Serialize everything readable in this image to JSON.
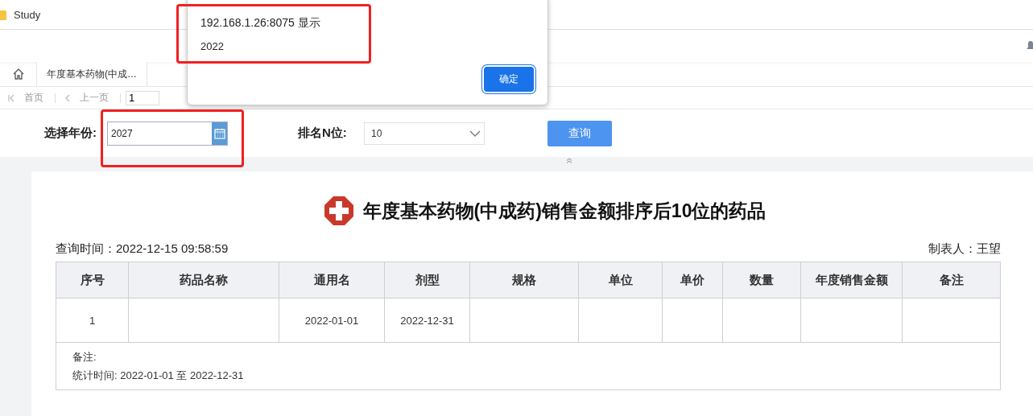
{
  "window": {
    "title": "Study"
  },
  "tabs": [
    {
      "label": "年度基本药物(中成…",
      "selected": true
    }
  ],
  "pager": {
    "buttons": [
      {
        "label": "首页",
        "kind": "first",
        "disabled": true
      },
      {
        "label": "上一页",
        "kind": "prev",
        "disabled": true
      }
    ],
    "page": "1"
  },
  "filters": {
    "year_label": "选择年份:",
    "year_value": "2027",
    "rank_label": "排名N位:",
    "rank_value": "10",
    "query_button": "查询"
  },
  "report": {
    "title": "年度基本药物(中成药)销售金额排序后10位的药品",
    "query_time": "查询时间：2022-12-15 09:58:59",
    "author": "制表人：王望",
    "columns": [
      "序号",
      "药品名称",
      "通用名",
      "剂型",
      "规格",
      "单位",
      "单价",
      "数量",
      "年度销售金额",
      "备注"
    ],
    "rows": [
      {
        "cells": [
          "1",
          null,
          "2022-01-01",
          "2022-12-31",
          null,
          null,
          null,
          null,
          null,
          null
        ]
      }
    ],
    "notes": [
      "备注:",
      "统计时间: 2022-01-01 至 2022-12-31"
    ]
  },
  "dialog": {
    "origin": "192.168.1.26:8075 显示",
    "message": "2022",
    "button": "确定"
  }
}
